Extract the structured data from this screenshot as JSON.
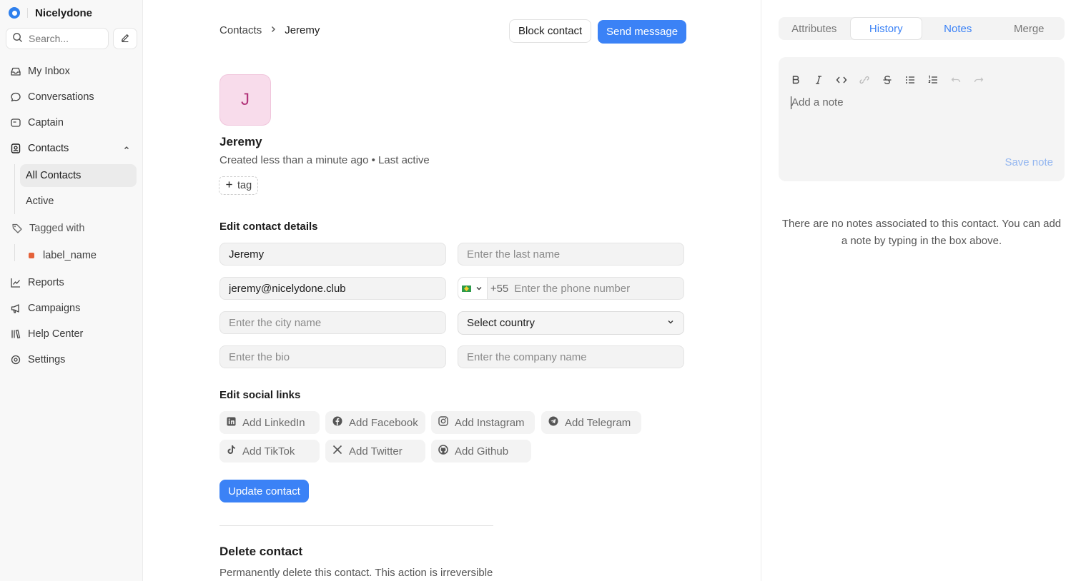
{
  "app": {
    "name": "Nicelydone"
  },
  "search": {
    "placeholder": "Search..."
  },
  "sidebar": {
    "items": [
      {
        "label": "My Inbox",
        "icon": "inbox-icon"
      },
      {
        "label": "Conversations",
        "icon": "chat-icon"
      },
      {
        "label": "Captain",
        "icon": "captain-icon"
      },
      {
        "label": "Contacts",
        "icon": "contacts-icon"
      },
      {
        "label": "Tagged with",
        "icon": "tag-icon"
      },
      {
        "label": "Reports",
        "icon": "chart-icon"
      },
      {
        "label": "Campaigns",
        "icon": "megaphone-icon"
      },
      {
        "label": "Help Center",
        "icon": "library-icon"
      },
      {
        "label": "Settings",
        "icon": "gear-icon"
      }
    ],
    "contacts_sub": [
      {
        "label": "All Contacts",
        "active": true
      },
      {
        "label": "Active",
        "active": false
      }
    ],
    "label": {
      "name": "label_name",
      "color": "#e5623a"
    }
  },
  "header": {
    "breadcrumb": [
      "Contacts",
      "Jeremy"
    ],
    "block_label": "Block contact",
    "send_label": "Send message"
  },
  "contact": {
    "initial": "J",
    "name": "Jeremy",
    "meta": "Created less than a minute ago • Last active",
    "tag_label": "tag"
  },
  "form": {
    "title": "Edit contact details",
    "first_name": "Jeremy",
    "last_name_placeholder": "Enter the last name",
    "email": "jeremy@nicelydone.club",
    "dial_code": "+55",
    "phone_placeholder": "Enter the phone number",
    "city_placeholder": "Enter the city name",
    "country_label": "Select country",
    "bio_placeholder": "Enter the bio",
    "company_placeholder": "Enter the company name"
  },
  "social": {
    "title": "Edit social links",
    "links": [
      {
        "label": "Add LinkedIn",
        "icon": "linkedin-icon"
      },
      {
        "label": "Add Facebook",
        "icon": "facebook-icon"
      },
      {
        "label": "Add Instagram",
        "icon": "instagram-icon"
      },
      {
        "label": "Add Telegram",
        "icon": "telegram-icon"
      },
      {
        "label": "Add TikTok",
        "icon": "tiktok-icon"
      },
      {
        "label": "Add Twitter",
        "icon": "twitter-icon"
      },
      {
        "label": "Add Github",
        "icon": "github-icon"
      }
    ]
  },
  "update_label": "Update contact",
  "delete": {
    "title": "Delete contact",
    "description": "Permanently delete this contact. This action is irreversible"
  },
  "right": {
    "tabs": [
      {
        "label": "Attributes",
        "state": "inactive"
      },
      {
        "label": "History",
        "state": "active"
      },
      {
        "label": "Notes",
        "state": "highlight"
      },
      {
        "label": "Merge",
        "state": "inactive"
      }
    ],
    "note_placeholder": "Add a note",
    "save_label": "Save note",
    "empty_message": "There are no notes associated to this contact. You can add a note by typing in the box above."
  },
  "colors": {
    "accent": "#3b82f6",
    "avatar_bg": "#f8dceb",
    "avatar_text": "#b2357a"
  }
}
